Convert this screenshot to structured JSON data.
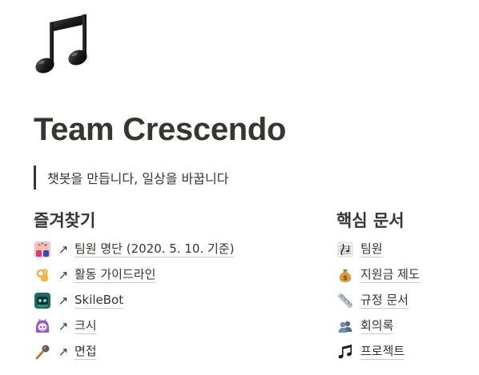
{
  "page": {
    "icon": "musical-notes-icon",
    "title": "Team Crescendo",
    "quote": "챗봇을 만듭니다, 일상을 바꿉니다"
  },
  "favorites": {
    "heading": "즐겨찾기",
    "items": [
      {
        "icon": "couple-heart-icon",
        "arrow": "↗",
        "label": "팀원 명단 (2020. 5. 10. 기준)"
      },
      {
        "icon": "ok-hand-icon",
        "arrow": "↗",
        "label": "활동 가이드라인"
      },
      {
        "icon": "skilebot-robot-icon",
        "arrow": "↗",
        "label": "SkileBot"
      },
      {
        "icon": "purple-girl-avatar-icon",
        "arrow": "↗",
        "label": "크시"
      },
      {
        "icon": "microphone-icon",
        "arrow": "↗",
        "label": "면접"
      }
    ]
  },
  "core_docs": {
    "heading": "핵심 문서",
    "items": [
      {
        "icon": "musical-score-icon",
        "label": "팀원"
      },
      {
        "icon": "money-bag-icon",
        "label": "지원금 제도"
      },
      {
        "icon": "ruler-icon",
        "label": "규정 문서"
      },
      {
        "icon": "busts-icon",
        "label": "회의록"
      },
      {
        "icon": "musical-notes-icon",
        "label": "프로젝트"
      }
    ]
  },
  "colors": {
    "text": "#37352f",
    "quote_bar": "#37352f",
    "link_underline": "rgba(55,53,47,0.25)"
  }
}
